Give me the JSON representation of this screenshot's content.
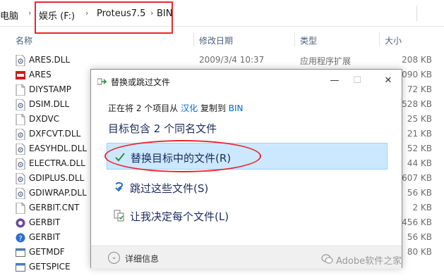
{
  "address": {
    "root": "电脑",
    "drive": "娱乐 (F:)",
    "folder": "Proteus7.5",
    "current": "BIN"
  },
  "columns": {
    "name": "名称",
    "date": "修改日期",
    "type": "类型",
    "size": "大小"
  },
  "files": [
    {
      "name": "ARES.DLL",
      "date": "2009/3/4 10:37",
      "type": "应用程序扩展",
      "size": "208 KB",
      "icon": "dll-file-icon"
    },
    {
      "name": "ARES",
      "date": "",
      "type": "",
      "size": "090 KB",
      "icon": "ares-app-icon"
    },
    {
      "name": "DIYSTAMP",
      "date": "",
      "type": "",
      "size": "72 KB",
      "icon": "file-icon"
    },
    {
      "name": "DSIM.DLL",
      "date": "",
      "type": "",
      "size": "528 KB",
      "icon": "dll-file-icon"
    },
    {
      "name": "DXDVC",
      "date": "",
      "type": "",
      "size": "25 KB",
      "icon": "file-icon"
    },
    {
      "name": "DXFCVT.DLL",
      "date": "",
      "type": "",
      "size": "21 KB",
      "icon": "dll-file-icon"
    },
    {
      "name": "EASYHDL.DLL",
      "date": "",
      "type": "",
      "size": "52 KB",
      "icon": "dll-file-icon"
    },
    {
      "name": "ELECTRA.DLL",
      "date": "",
      "type": "",
      "size": "44 KB",
      "icon": "dll-file-icon"
    },
    {
      "name": "GDIPLUS.DLL",
      "date": "",
      "type": "",
      "size": "607 KB",
      "icon": "dll-file-icon"
    },
    {
      "name": "GDIWRAP.DLL",
      "date": "",
      "type": "",
      "size": "56 KB",
      "icon": "dll-file-icon"
    },
    {
      "name": "GERBIT.CNT",
      "date": "",
      "type": "",
      "size": "2 KB",
      "icon": "file-icon"
    },
    {
      "name": "GERBIT",
      "date": "",
      "type": "",
      "size": "456 KB",
      "icon": "gerbit-app-icon"
    },
    {
      "name": "GERBIT",
      "date": "",
      "type": "",
      "size": "56 KB",
      "icon": "help-file-icon"
    },
    {
      "name": "GETMDF",
      "date": "",
      "type": "",
      "size": "80 KB",
      "icon": "app-icon"
    },
    {
      "name": "GETSPICE",
      "date": "",
      "type": "",
      "size": "",
      "icon": "app-icon"
    }
  ],
  "dialog": {
    "title": "替换或跳过文件",
    "copy_prefix": "正在将 2 个项目从",
    "source": "汉化",
    "copy_mid": "复制到",
    "dest": "BIN",
    "conflict": "目标包含 2 个同名文件",
    "opt_replace": "替换目标中的文件(R)",
    "opt_skip": "跳过这些文件(S)",
    "opt_decide": "让我决定每个文件(L)",
    "details": "详细信息",
    "minimize": "—",
    "maximize": "☐",
    "close": "✕"
  },
  "watermark": "Adobe软件之家",
  "colors": {
    "highlight_red": "#e8282d",
    "selected_bg": "#cce8ff",
    "link_blue": "#0066cc"
  }
}
